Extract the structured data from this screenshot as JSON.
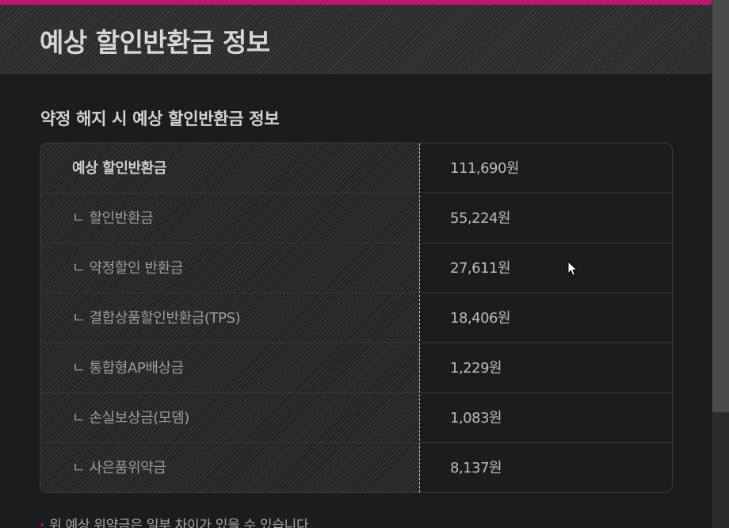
{
  "header": {
    "title": "예상 할인반환금 정보"
  },
  "section": {
    "title": "약정 해지 시 예상 할인반환금 정보"
  },
  "table": {
    "rows": [
      {
        "label": "예상 할인반환금",
        "value": "111,690원"
      },
      {
        "label": "ㄴ 할인반환금",
        "value": "55,224원"
      },
      {
        "label": "ㄴ 약정할인 반환금",
        "value": "27,611원"
      },
      {
        "label": "ㄴ 결합상품할인반환금(TPS)",
        "value": "18,406원"
      },
      {
        "label": "ㄴ 통합형AP배상금",
        "value": "1,229원"
      },
      {
        "label": "ㄴ 손실보상금(모뎀)",
        "value": "1,083원"
      },
      {
        "label": "ㄴ 사은품위약금",
        "value": "8,137원"
      }
    ]
  },
  "footnote": {
    "bullet": "·",
    "text": "위 예상 위약금은 일부 차이가 있을 수 있습니다."
  },
  "colors": {
    "accent": "#c2156f",
    "background": "#1b1c1e"
  }
}
